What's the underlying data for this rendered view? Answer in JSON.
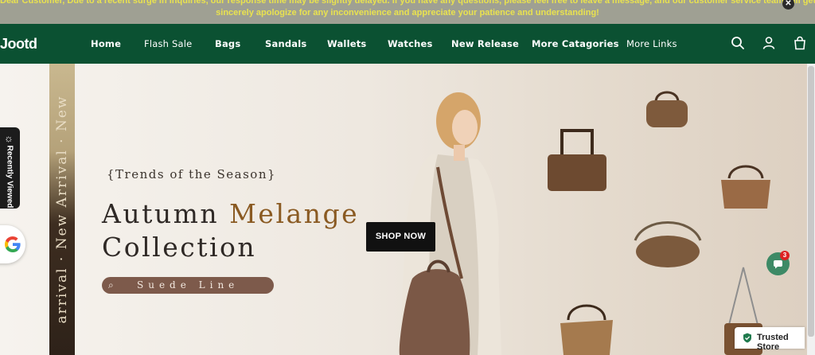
{
  "announcement": {
    "line1": "Dear Customer, Due to a recent surge in inquiries, our response time may be slightly delayed. If you have any questions, please feel free to leave a message, and our customer service team will get back to you within 24 hours. We",
    "line2": "sincerely apologize for any inconvenience and appreciate your patience and understanding!",
    "close_icon": "close-icon"
  },
  "nav": {
    "logo": "Jootd",
    "items": [
      "Home",
      "Flash Sale",
      "Bags",
      "Sandals",
      "Wallets",
      "Watches",
      "New Release",
      "More Catagories",
      "More Links"
    ],
    "icons": [
      "search-icon",
      "account-icon",
      "cart-icon"
    ]
  },
  "hero": {
    "vertical_text": "arrival · New Arrival · New",
    "trends": "{Trends of the Season}",
    "headline_1_a": "Autumn ",
    "headline_1_b": "Melange",
    "headline_2": "Collection",
    "pill_label": "Suede Line",
    "shop_button": "SHOP NOW"
  },
  "widgets": {
    "recently_viewed": "Recently Viewed",
    "chat_badge": "3",
    "trusted_store": "Trusted Store"
  },
  "colors": {
    "nav_bg": "#0b5132",
    "announce_bg": "#9fa093",
    "announce_text": "#e9e24f",
    "accent_brown": "#8a5a22"
  }
}
